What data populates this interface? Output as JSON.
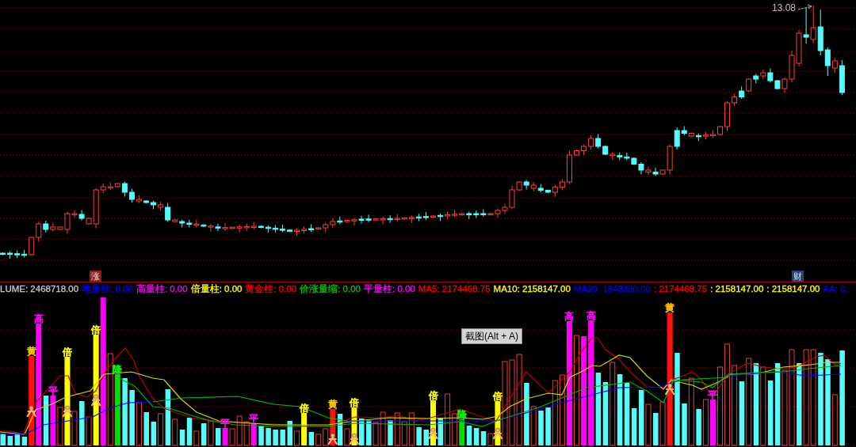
{
  "price_chart": {
    "high_label": "13.08",
    "markers": [
      {
        "text": "涨",
        "color": "#8e1f1f"
      },
      {
        "text": "财",
        "color": "#24447c"
      }
    ]
  },
  "volume_legend": [
    {
      "text": "LUME: 2468718.00",
      "color": "#c8c8c8"
    },
    {
      "text": "地量柱: 0.00",
      "color": "#0000ff"
    },
    {
      "text": "高量柱: 0.00",
      "color": "#ff00ff"
    },
    {
      "text": "倍量柱: 0.00",
      "color": "#ffff00"
    },
    {
      "text": "黄金柱: 0.00",
      "color": "#ff0000"
    },
    {
      "text": "价涨量缩: 0.00",
      "color": "#00c800"
    },
    {
      "text": "平量柱: 0.00",
      "color": "#ff00ff"
    },
    {
      "text": "MA5: 2174468.75",
      "color": "#ff0000"
    },
    {
      "text": "MA10: 2158147.00",
      "color": "#ffff00"
    },
    {
      "text": "MA30: 1843380.00",
      "color": "#0000ff"
    },
    {
      "text": ": 2174468.75",
      "color": "#ff0000"
    },
    {
      "text": ": 2158147.00",
      "color": "#ffff00"
    },
    {
      "text": ": 2158147.00",
      "color": "#ffff00"
    },
    {
      "text": "AA: 0.",
      "color": "#0000ff"
    }
  ],
  "volume_chart": {
    "bar_tags": [
      {
        "text": "黄",
        "color": "#ffc000"
      },
      {
        "text": "高",
        "color": "#ff00ff"
      },
      {
        "text": "平",
        "color": "#ff00ff"
      },
      {
        "text": "倍",
        "color": "#ffff00"
      },
      {
        "text": "倍",
        "color": "#ffff00"
      },
      {
        "text": "降",
        "color": "#00ff00"
      },
      {
        "text": "平",
        "color": "#ff00ff"
      },
      {
        "text": "平",
        "color": "#ff00ff"
      },
      {
        "text": "倍",
        "color": "#ffff00"
      },
      {
        "text": "黄",
        "color": "#ffc000"
      },
      {
        "text": "倍",
        "color": "#ffff00"
      },
      {
        "text": "倍",
        "color": "#ffff00"
      },
      {
        "text": "降",
        "color": "#00ff00"
      },
      {
        "text": "倍",
        "color": "#ffff00"
      },
      {
        "text": "高",
        "color": "#ff00ff"
      },
      {
        "text": "高",
        "color": "#ff00ff"
      },
      {
        "text": "黄",
        "color": "#ffc000"
      },
      {
        "text": "平",
        "color": "#ff00ff"
      }
    ]
  },
  "tooltip": {
    "text": "截图(Alt + A)"
  }
}
